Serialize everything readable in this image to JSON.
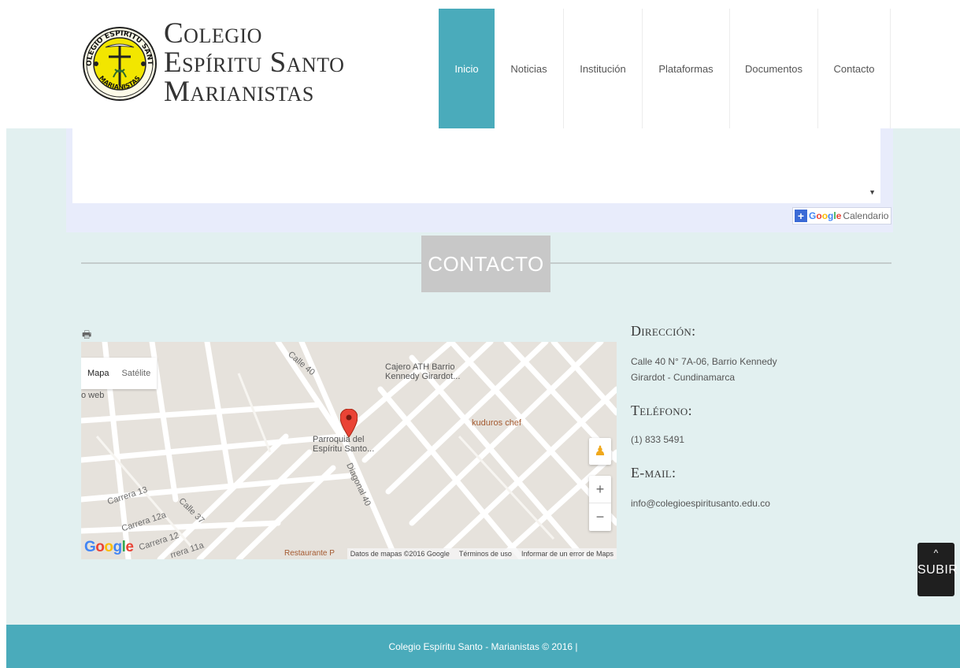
{
  "header": {
    "brand_line1": "Colegio",
    "brand_line2": "Espíritu Santo",
    "brand_line3": "Marianistas",
    "seal_top_text": "COLEGIO ESPIRITU SANTO",
    "seal_bottom_text": "MARIANISTAS"
  },
  "nav": {
    "items": [
      {
        "label": "Inicio",
        "active": true
      },
      {
        "label": "Noticias",
        "active": false
      },
      {
        "label": "Institución",
        "active": false
      },
      {
        "label": "Plataformas",
        "active": false
      },
      {
        "label": "Documentos",
        "active": false
      },
      {
        "label": "Contacto",
        "active": false
      }
    ]
  },
  "calendar": {
    "button_plus": "+",
    "google_label": "Google",
    "calendar_label": "Calendario"
  },
  "section": {
    "title": "CONTACTO"
  },
  "map": {
    "type_map": "Mapa",
    "type_satellite": "Satélite",
    "labels": {
      "cajero": "Cajero ATH Barrio\nKennedy Girardot...",
      "kuduros": "kuduros chef",
      "parroquia": "Parroquia del\nEspíritu Santo...",
      "web": "o web",
      "restaurante": "Restaurante P"
    },
    "streets": {
      "calle40": "Calle 40",
      "diagonal40": "Diagonal 40",
      "carrera13": "Carrera 13",
      "carrera12a": "Carrera 12a",
      "carrera12": "Carrera 12",
      "calle37": "Calle 37",
      "carrera11a": "rrera 11a"
    },
    "google_logo": "Google",
    "footer": {
      "data": "Datos de mapas ©2016 Google",
      "terms": "Términos de uso",
      "report": "Informar de un error de Maps"
    },
    "zoom_in": "+",
    "zoom_out": "−"
  },
  "contact": {
    "direccion_heading": "Dirección:",
    "direccion_line1": "Calle 40 N° 7A-06, Barrio Kennedy",
    "direccion_line2": "Girardot - Cundinamarca",
    "telefono_heading": "Teléfono:",
    "telefono": "(1) 833 5491",
    "email_heading": "E-mail:",
    "email": "info@colegioespiritusanto.edu.co"
  },
  "subir": {
    "arrow": "^",
    "label": "SUBIR"
  },
  "footer": {
    "text": "Colegio Espíritu Santo - Marianistas © 2016 |"
  },
  "colors": {
    "accent": "#4aabbb",
    "content_bg": "#e2f0f0",
    "seal_yellow": "#f2e600",
    "pin_red": "#ea4335"
  }
}
